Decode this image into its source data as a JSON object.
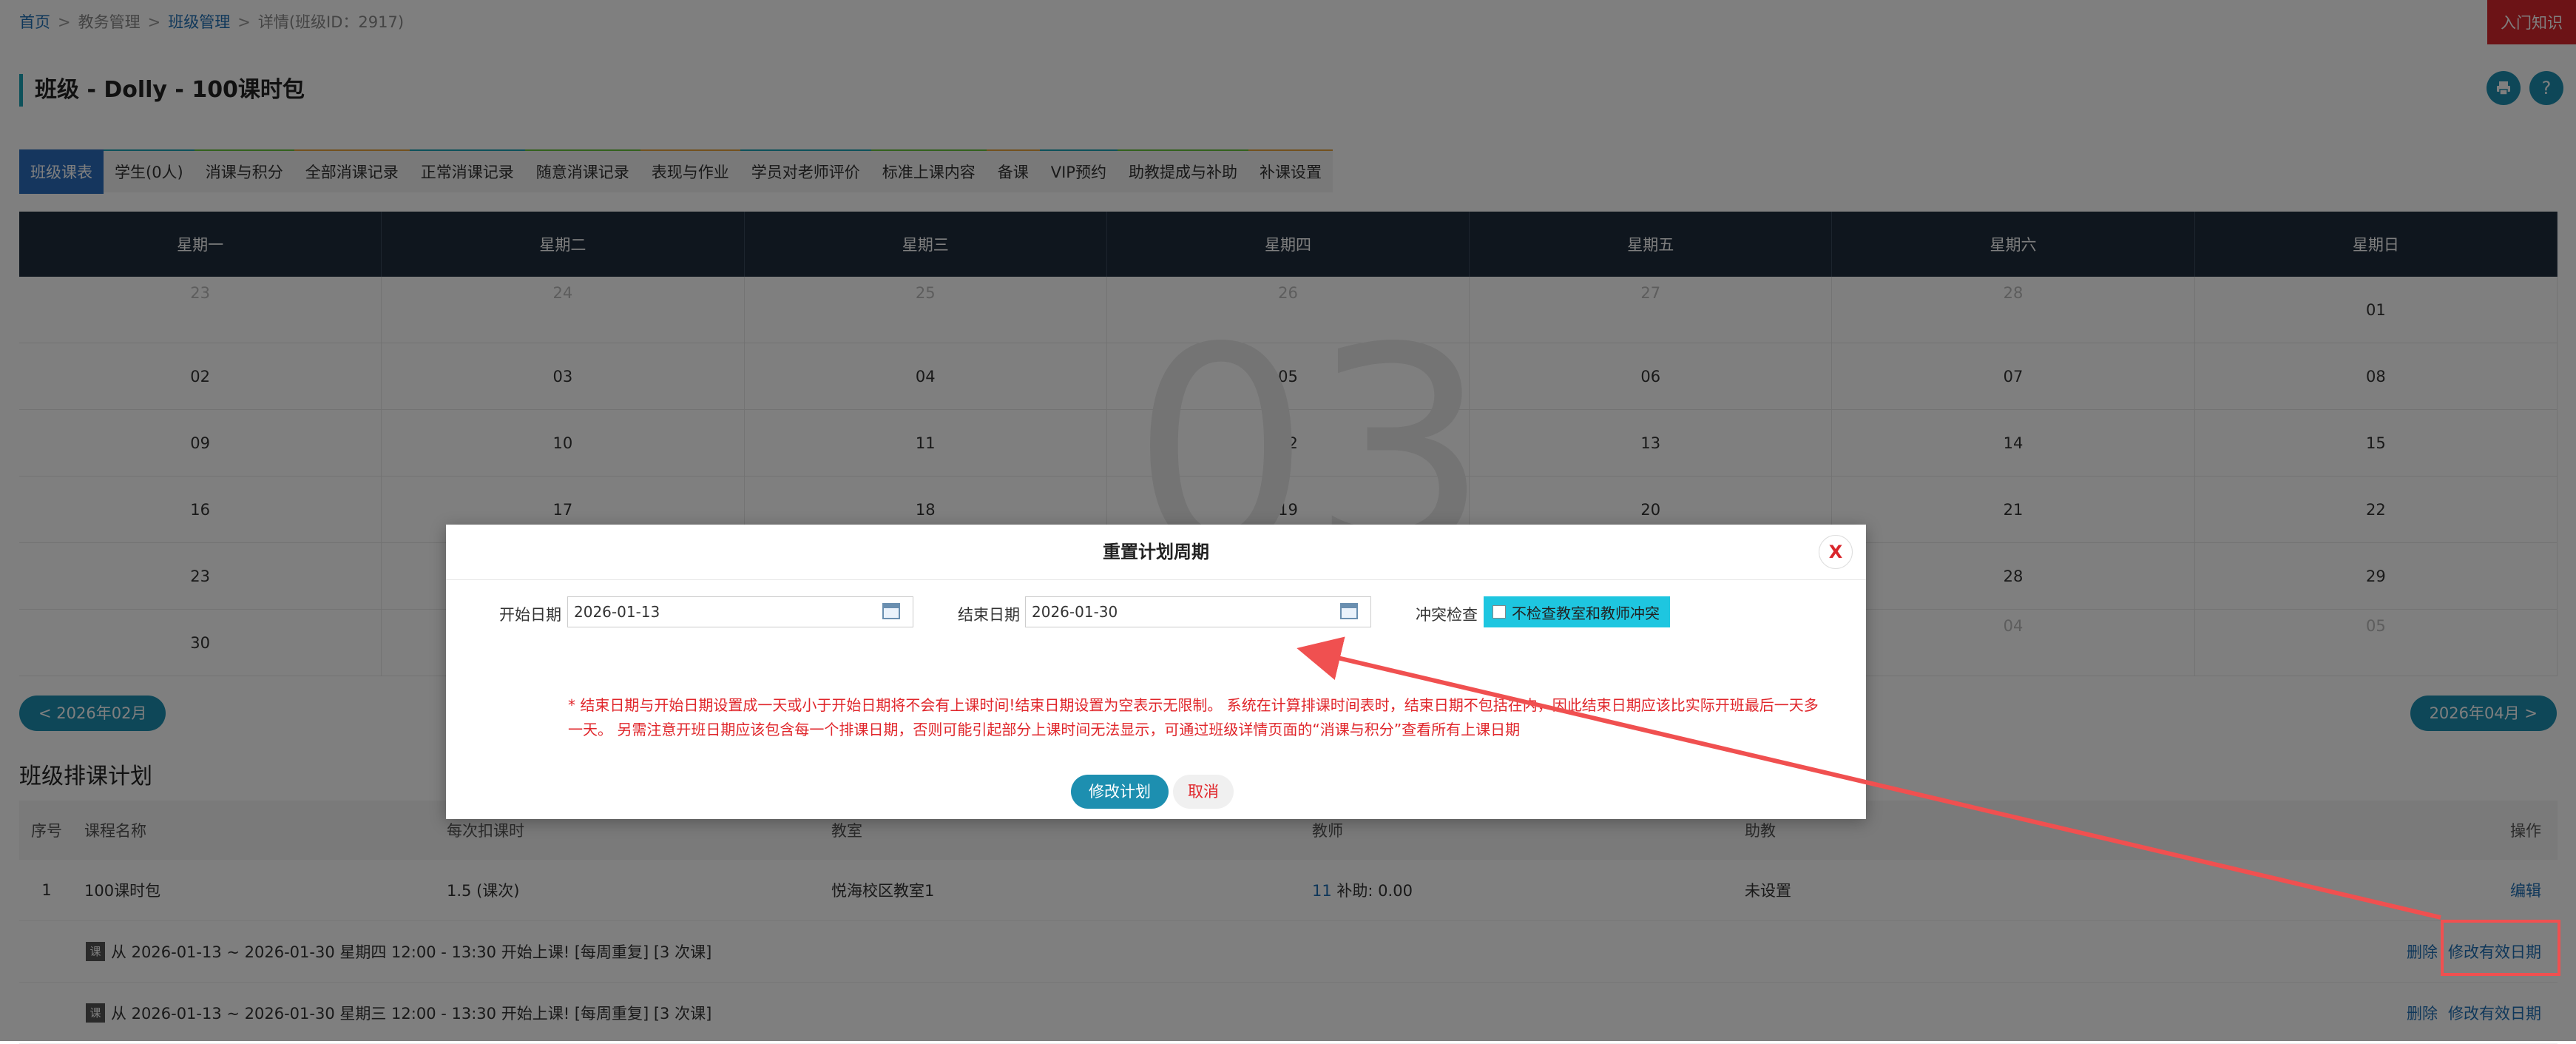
{
  "breadcrumb": {
    "home": "首页",
    "sep": ">",
    "edu": "教务管理",
    "class_mgmt": "班级管理",
    "detail": "详情(班级ID：2917)"
  },
  "corner_help": "入门知识",
  "page_title": "班级 - Dolly - 100课时包",
  "tabs": [
    "班级课表",
    "学生(0人)",
    "消课与积分",
    "全部消课记录",
    "正常消课记录",
    "随意消课记录",
    "表现与作业",
    "学员对老师评价",
    "标准上课内容",
    "备课",
    "VIP预约",
    "助教提成与补助",
    "补课设置"
  ],
  "calendar": {
    "weekdays": [
      "星期一",
      "星期二",
      "星期三",
      "星期四",
      "星期五",
      "星期六",
      "星期日"
    ],
    "month_watermark": "03",
    "rows": [
      [
        "23",
        "24",
        "25",
        "26",
        "27",
        "28",
        "01"
      ],
      [
        "02",
        "03",
        "04",
        "05",
        "06",
        "07",
        "08"
      ],
      [
        "09",
        "10",
        "11",
        "12",
        "13",
        "14",
        "15"
      ],
      [
        "16",
        "17",
        "18",
        "19",
        "20",
        "21",
        "22"
      ],
      [
        "23",
        "",
        "",
        "",
        "",
        "28",
        "29"
      ],
      [
        "30",
        "",
        "",
        "",
        "",
        "04",
        "05"
      ]
    ],
    "prev_btn": "< 2026年02月",
    "next_btn": "2026年04月 >"
  },
  "plan": {
    "title": "班级排课计划",
    "headers": [
      "序号",
      "课程名称",
      "每次扣课时",
      "教室",
      "教师",
      "助教",
      "操作"
    ],
    "row": {
      "no": "1",
      "course": "100课时包",
      "deduct": "1.5 (课次)",
      "room": "悦海校区教室1",
      "teacher_num": "11",
      "teacher_rest": "补助: 0.00",
      "assistant": "未设置",
      "edit": "编辑"
    },
    "badge": "课",
    "schedules": [
      {
        "text": "从 2026-01-13 ~ 2026-01-30 星期四 12:00 - 13:30 开始上课! [每周重复] [3 次课]",
        "del": "删除",
        "modify": "修改有效日期"
      },
      {
        "text": "从 2026-01-13 ~ 2026-01-30 星期三 12:00 - 13:30 开始上课! [每周重复] [3 次课]",
        "del": "删除",
        "modify": "修改有效日期"
      }
    ]
  },
  "modal": {
    "title": "重置计划周期",
    "close": "X",
    "start_label": "开始日期",
    "start_value": "2026-01-13",
    "end_label": "结束日期",
    "end_value": "2026-01-30",
    "conflict_label": "冲突检查",
    "conflict_option": "不检查教室和教师冲突",
    "note": "* 结束日期与开始日期设置成一天或小于开始日期将不会有上课时间!结束日期设置为空表示无限制。 系统在计算排课时间表时，结束日期不包括在内，因此结束日期应该比实际开班最后一天多一天。 另需注意开班日期应该包含每一个排课日期，否则可能引起部分上课时间无法显示，可通过班级详情页面的“消课与积分”查看所有上课日期",
    "ok": "修改计划",
    "cancel": "取消"
  },
  "colors": {
    "accent": "#1d8fb0",
    "tab_active": "#2a6dbd",
    "header_dark": "#1f2d3d",
    "warn_red": "#e0262b",
    "annotation": "#f05050"
  },
  "icons": {
    "print": "printer-icon",
    "help": "question-icon",
    "calendar": "calendar-icon"
  }
}
